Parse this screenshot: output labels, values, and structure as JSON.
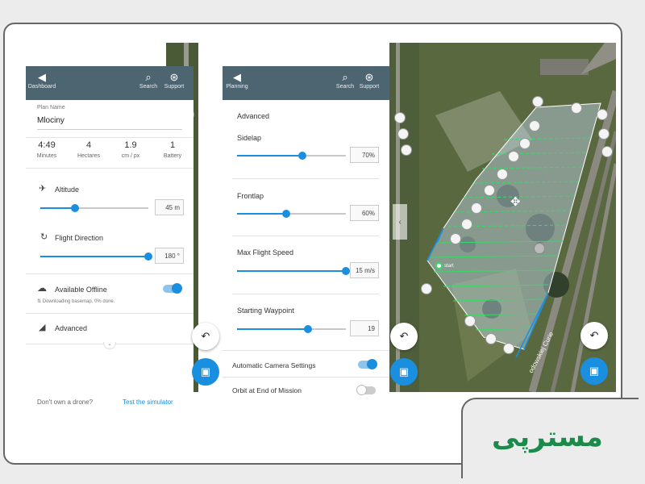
{
  "left_panel": {
    "back_label": "Dashboard",
    "search_label": "Search",
    "support_label": "Support",
    "plan_name_label": "Plan Name",
    "plan_name_value": "Mlociny",
    "stats": [
      {
        "value": "4:49",
        "label": "Minutes"
      },
      {
        "value": "4",
        "label": "Hectares"
      },
      {
        "value": "1.9",
        "label": "cm / px"
      },
      {
        "value": "1",
        "label": "Battery"
      }
    ],
    "altitude_label": "Altitude",
    "altitude_value": "45 m",
    "altitude_level": 0.32,
    "direction_label": "Flight Direction",
    "direction_value": "180 °",
    "direction_level": 1.0,
    "offline_label": "Available Offline",
    "offline_status": "Downloading basemap, 0% done.",
    "advanced_label": "Advanced",
    "no_drone_text": "Don't own a drone?",
    "simulator_link": "Test the simulator"
  },
  "middle_panel": {
    "back_label": "Planning",
    "search_label": "Search",
    "support_label": "Support",
    "header": "Advanced",
    "sliders": [
      {
        "label": "Sidelap",
        "value": "70%",
        "level": 0.6
      },
      {
        "label": "Frontlap",
        "value": "60%",
        "level": 0.45
      },
      {
        "label": "Max Flight Speed",
        "value": "15 m/s",
        "level": 1.0
      },
      {
        "label": "Starting Waypoint",
        "value": "19",
        "level": 0.65
      }
    ],
    "auto_camera_label": "Automatic Camera Settings",
    "orbit_label": "Orbit at End of Mission"
  },
  "map": {
    "start_label": "start",
    "street_label": "odowskiej Curie"
  },
  "icons": {
    "back": "chevron-left-icon",
    "search": "search-icon",
    "support": "lifebuoy-icon",
    "undo": "undo-icon",
    "save": "save-icon",
    "move": "move-icon"
  },
  "colors": {
    "topbar": "#4d6471",
    "accent": "#1a8fe0",
    "flight_line": "#33dd66"
  },
  "logo": {
    "text": "مسترپی"
  }
}
